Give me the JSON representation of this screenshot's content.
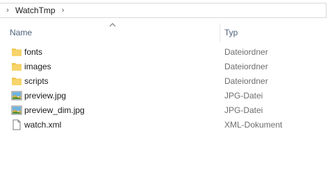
{
  "breadcrumb": {
    "items": [
      {
        "label": "WatchTmp"
      }
    ]
  },
  "columns": {
    "name_label": "Name",
    "type_label": "Typ",
    "sorted_by": "name",
    "sort_direction": "ascending"
  },
  "files": [
    {
      "name": "fonts",
      "type": "Dateiordner",
      "icon": "folder-icon"
    },
    {
      "name": "images",
      "type": "Dateiordner",
      "icon": "folder-icon"
    },
    {
      "name": "scripts",
      "type": "Dateiordner",
      "icon": "folder-icon"
    },
    {
      "name": "preview.jpg",
      "type": "JPG-Datei",
      "icon": "image-file-icon"
    },
    {
      "name": "preview_dim.jpg",
      "type": "JPG-Datei",
      "icon": "image-file-icon"
    },
    {
      "name": "watch.xml",
      "type": "XML-Dokument",
      "icon": "document-file-icon"
    }
  ],
  "colors": {
    "folder": "#f0c44e",
    "header_text": "#4c607a",
    "type_text": "#6d6d6d"
  }
}
